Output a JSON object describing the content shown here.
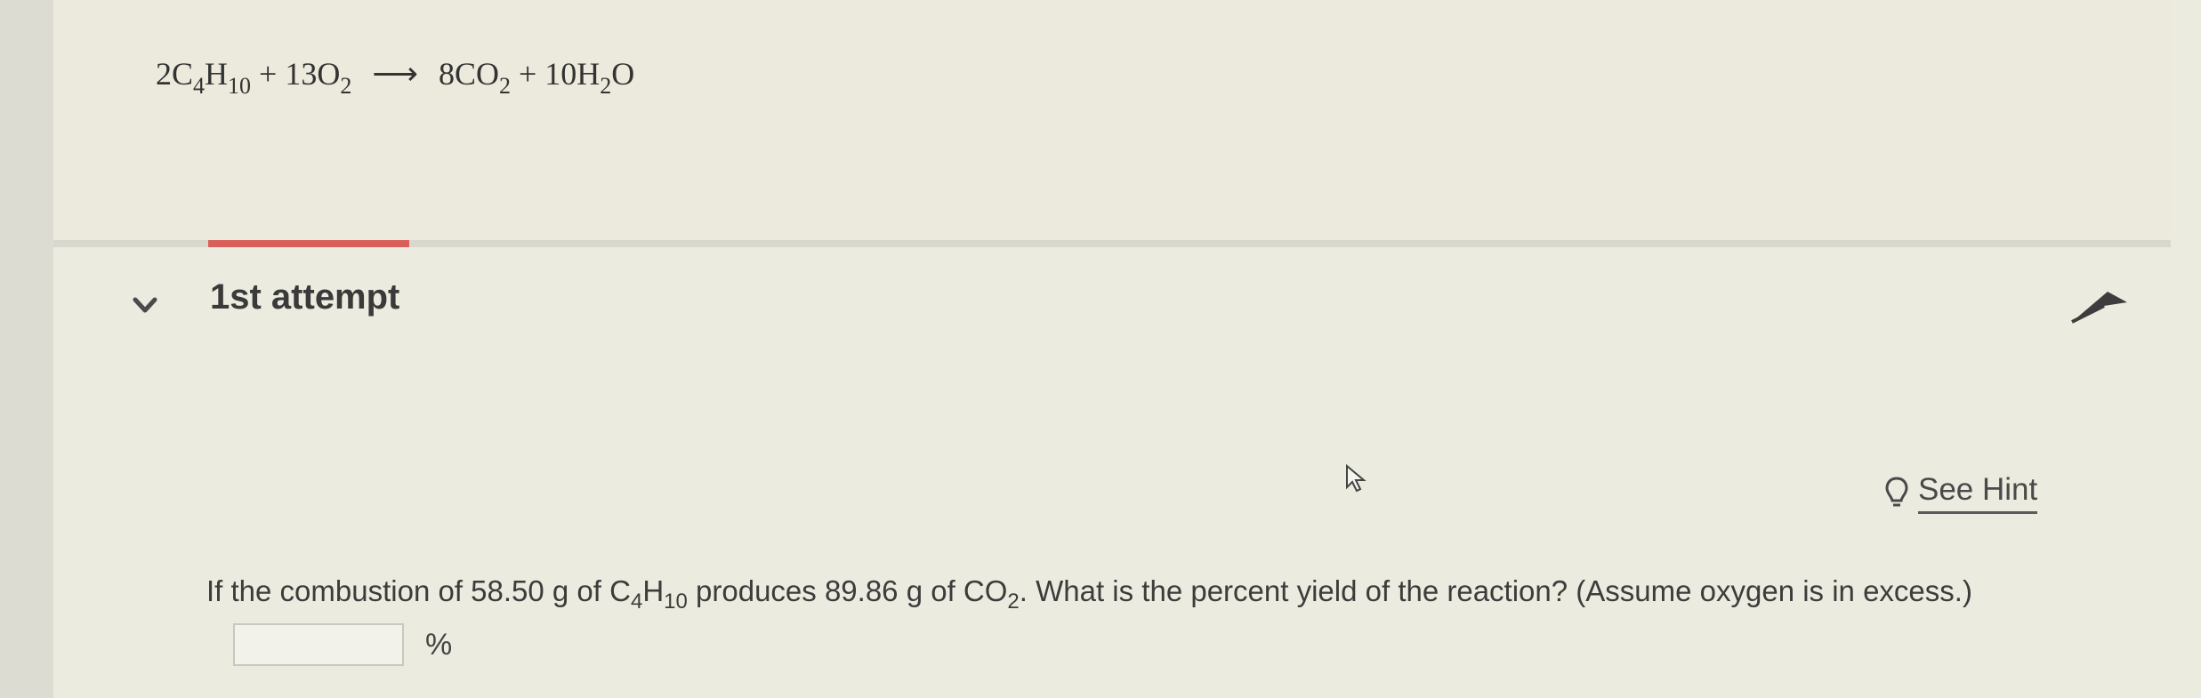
{
  "equation": {
    "r1_coef": "2C",
    "r1_sub1": "4",
    "r1_mid": "H",
    "r1_sub2": "10",
    "plus1": "+ 13O",
    "r2_sub": "2",
    "arrow": "⟶",
    "p1": "8CO",
    "p1_sub": "2",
    "plus2": "+ 10H",
    "p2_sub": "2",
    "p2_end": "O"
  },
  "attempt": {
    "title": "1st attempt"
  },
  "hint": {
    "label": "See Hint",
    "icon": "lightbulb-icon"
  },
  "question": {
    "part1": "If the combustion of 58.50 g of C",
    "sub1": "4",
    "part2": "H",
    "sub2": "10",
    "part3": " produces 89.86 g of CO",
    "sub3": "2",
    "part4": ". What is the percent yield of the reaction? (Assume oxygen is in excess.)"
  },
  "answer": {
    "value": "",
    "unit": "%"
  },
  "colors": {
    "progress": "#d9605a",
    "background": "#ecebdf"
  }
}
